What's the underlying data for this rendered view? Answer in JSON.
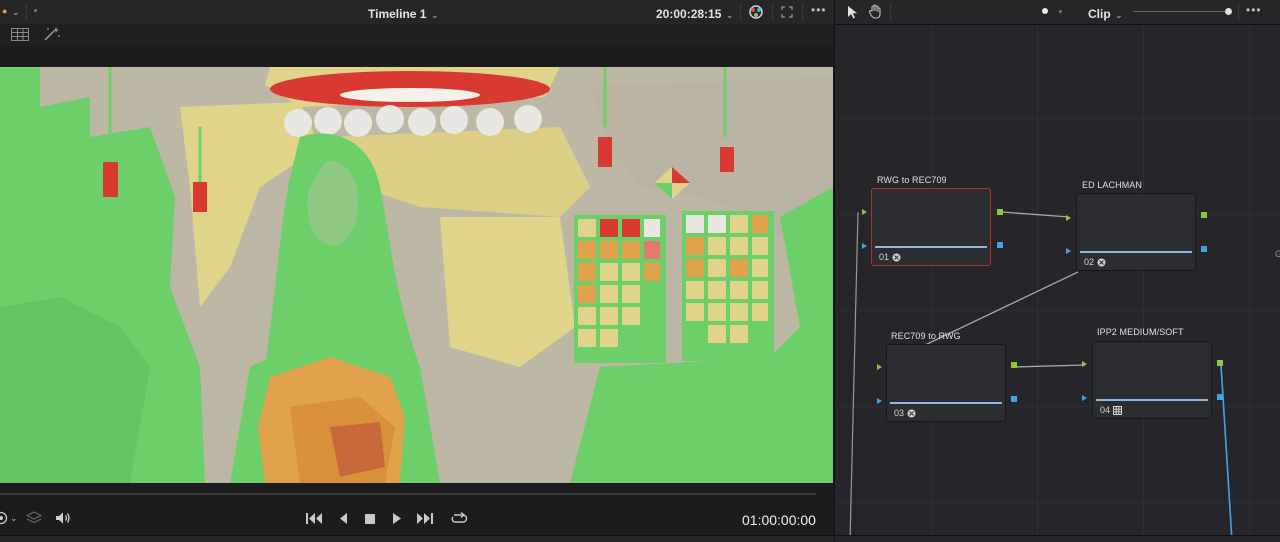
{
  "viewer": {
    "timeline_name": "Timeline 1",
    "source_timecode": "20:00:28:15",
    "record_timecode": "01:00:00:00"
  },
  "node_editor": {
    "mode_label": "Clip",
    "nodes": [
      {
        "label": "RWG to REC709",
        "number": "01",
        "selected": true
      },
      {
        "label": "ED LACHMAN",
        "number": "02",
        "selected": false
      },
      {
        "label": "REC709 to RWG",
        "number": "03",
        "selected": false
      },
      {
        "label": "IPP2 MEDIUM/SOFT",
        "number": "04",
        "selected": false
      }
    ]
  },
  "colors": {
    "accent_green": "#8dc63f",
    "accent_blue": "#3ba7e5",
    "selected_node": "#b53131",
    "false_color_green": "#6ccf6a",
    "false_color_yellow": "#e0d48a",
    "false_color_orange": "#e0a24a",
    "false_color_red": "#d83a32"
  },
  "icons": [
    "color-viewer-icon",
    "fullscreen-icon",
    "more-icon",
    "pointer-icon",
    "hand-icon",
    "grid-view-icon",
    "magic-wand-icon",
    "layers-icon",
    "speaker-icon",
    "first-frame-icon",
    "step-back-icon",
    "stop-icon",
    "play-icon",
    "last-frame-icon",
    "loop-icon",
    "fx-icon",
    "lut-icon"
  ]
}
